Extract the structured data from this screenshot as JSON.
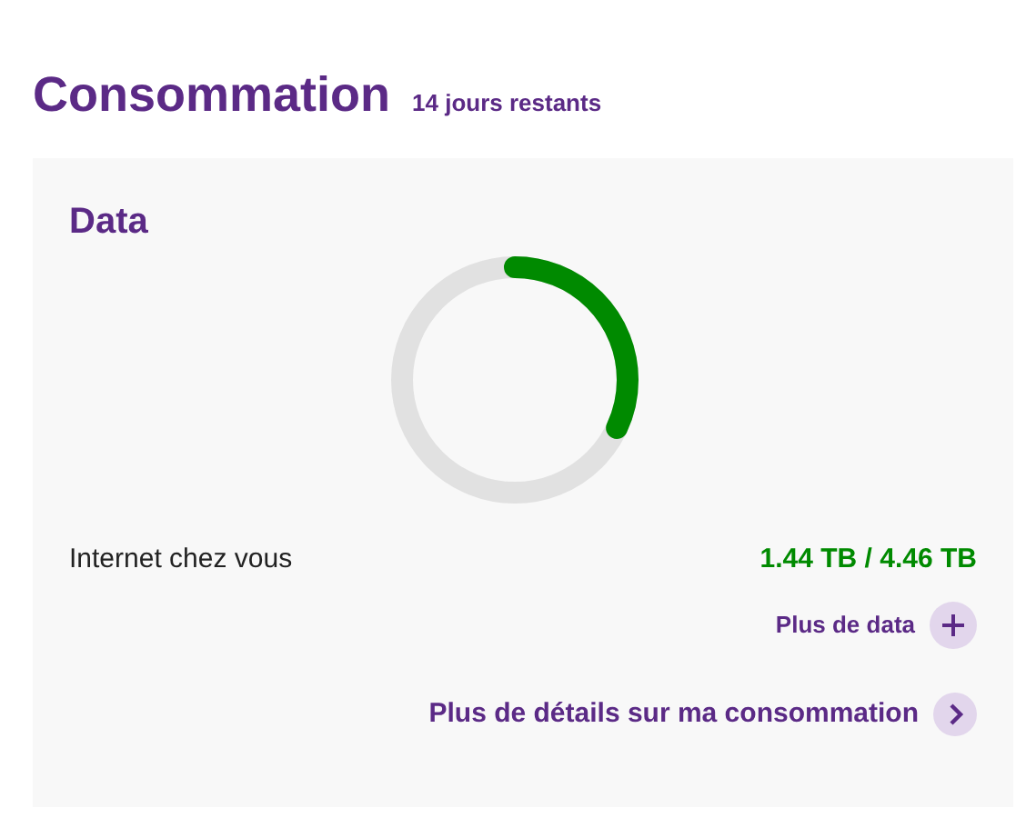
{
  "header": {
    "title": "Consommation",
    "subtitle": "14 jours restants"
  },
  "card": {
    "title": "Data",
    "usage": {
      "label": "Internet chez vous",
      "value": "1.44 TB / 4.46 TB"
    },
    "links": [
      {
        "kind": "plus",
        "label": "Plus de data"
      },
      {
        "kind": "chevron",
        "label": "Plus de détails sur ma consommation"
      }
    ]
  }
}
